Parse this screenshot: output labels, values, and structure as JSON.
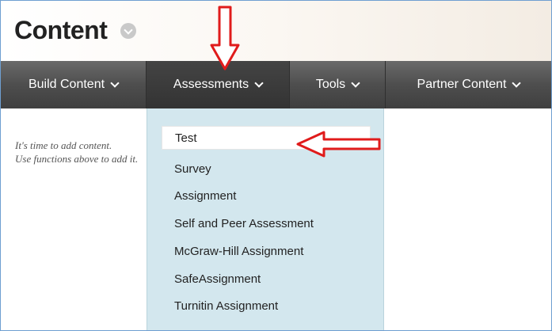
{
  "page": {
    "title": "Content"
  },
  "nav": {
    "items": [
      {
        "label": "Build Content"
      },
      {
        "label": "Assessments"
      },
      {
        "label": "Tools"
      },
      {
        "label": "Partner Content"
      }
    ]
  },
  "content": {
    "empty_line1": "It's time to add content.",
    "empty_line2": "Use functions above to add it."
  },
  "assessments_menu": {
    "items": [
      {
        "label": "Test"
      },
      {
        "label": "Survey"
      },
      {
        "label": "Assignment"
      },
      {
        "label": "Self and Peer Assessment"
      },
      {
        "label": "McGraw-Hill Assignment"
      },
      {
        "label": "SafeAssignment"
      },
      {
        "label": "Turnitin Assignment"
      }
    ],
    "selected": "Test"
  },
  "colors": {
    "frame_border": "#6f9fd1",
    "navbar": "#4e4e4e",
    "dropdown_bg": "#d3e7ee",
    "annotation_arrow": "#e01b1b"
  },
  "icons": {
    "title_badge": "chevron-down-circle-icon",
    "nav_caret": "chevron-down-icon",
    "annotations": [
      "red-arrow-down-icon",
      "red-arrow-left-icon"
    ]
  }
}
